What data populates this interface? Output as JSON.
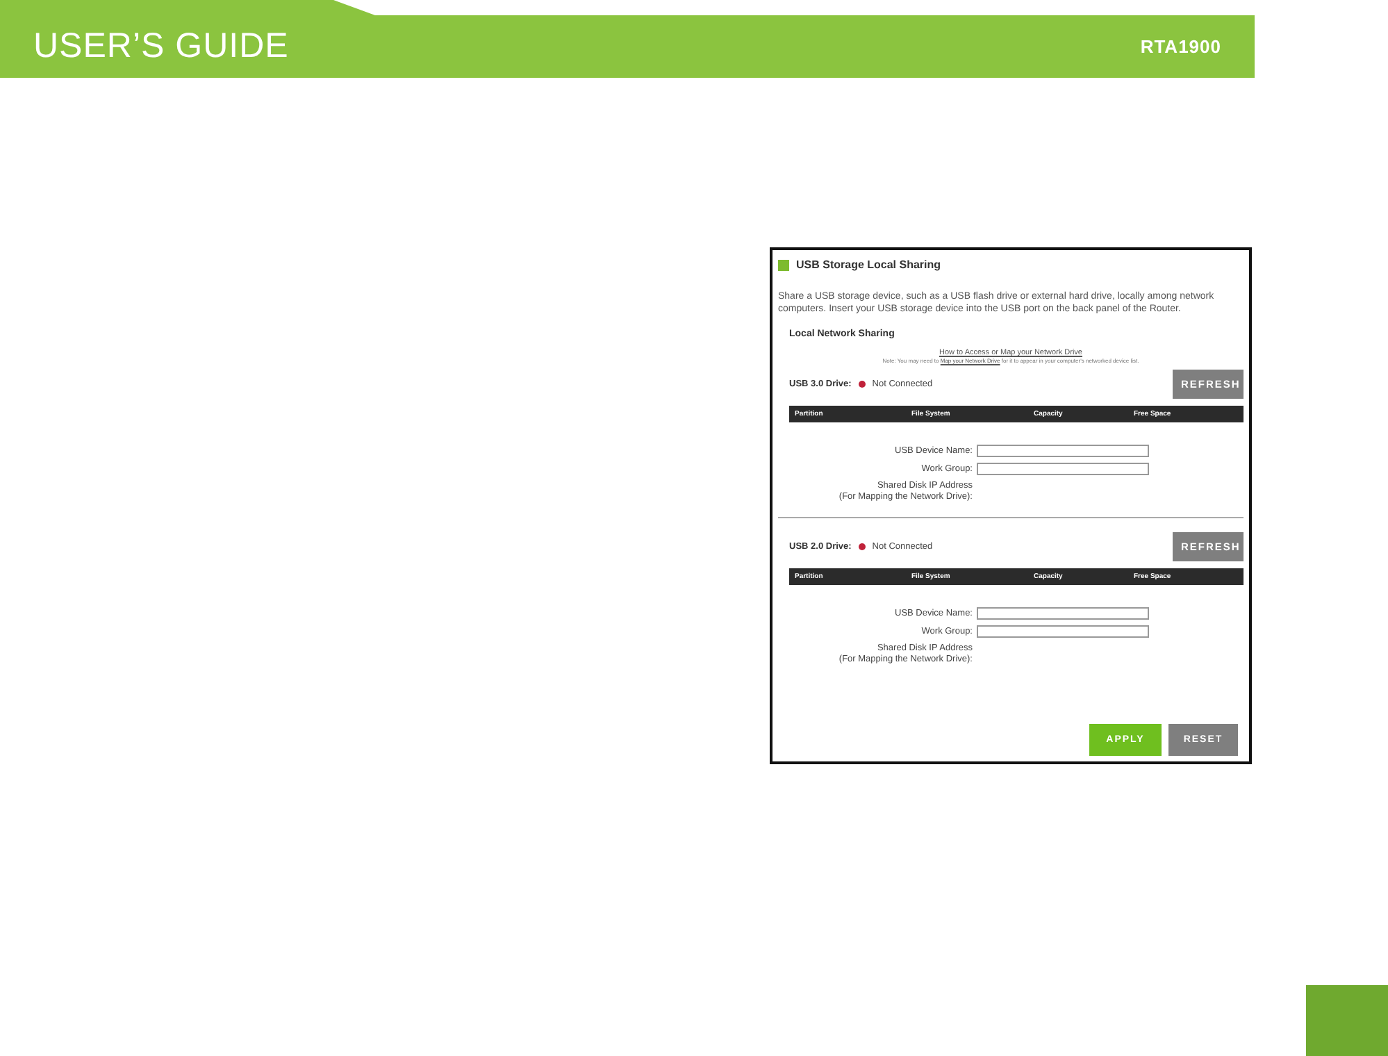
{
  "header": {
    "title": "USER’S GUIDE",
    "model": "RTA1900"
  },
  "panel": {
    "title": "USB Storage Local Sharing",
    "description": "Share a USB storage device, such as a USB flash drive or external hard drive, locally among network computers. Insert your USB storage device into the USB port on the back panel of the Router.",
    "section": "Local Network Sharing",
    "help_link": "How to Access or Map your Network Drive",
    "note_before": "Note: You may need to ",
    "note_link": "Map your Network Drive",
    "note_after": " for it to appear in your computer's networked device list.",
    "drives": [
      {
        "label": "USB 3.0 Drive:",
        "connected": false,
        "status": "Not Connected",
        "refresh": "REFRESH",
        "columns": [
          "Partition",
          "File System",
          "Capacity",
          "Free Space"
        ],
        "fields": [
          {
            "label": "USB Device Name:"
          },
          {
            "label": "Work Group:"
          }
        ],
        "ip_label": "Shared Disk IP Address",
        "ip_sub": "(For Mapping the Network Drive):"
      },
      {
        "label": "USB 2.0 Drive:",
        "connected": false,
        "status": "Not Connected",
        "refresh": "REFRESH",
        "columns": [
          "Partition",
          "File System",
          "Capacity",
          "Free Space"
        ],
        "fields": [
          {
            "label": "USB Device Name:"
          },
          {
            "label": "Work Group:"
          }
        ],
        "ip_label": "Shared Disk IP Address",
        "ip_sub": "(For Mapping the Network Drive):"
      }
    ],
    "buttons": [
      {
        "label": "APPLY",
        "kind": "primary"
      },
      {
        "label": "RESET",
        "kind": "secondary"
      }
    ]
  }
}
